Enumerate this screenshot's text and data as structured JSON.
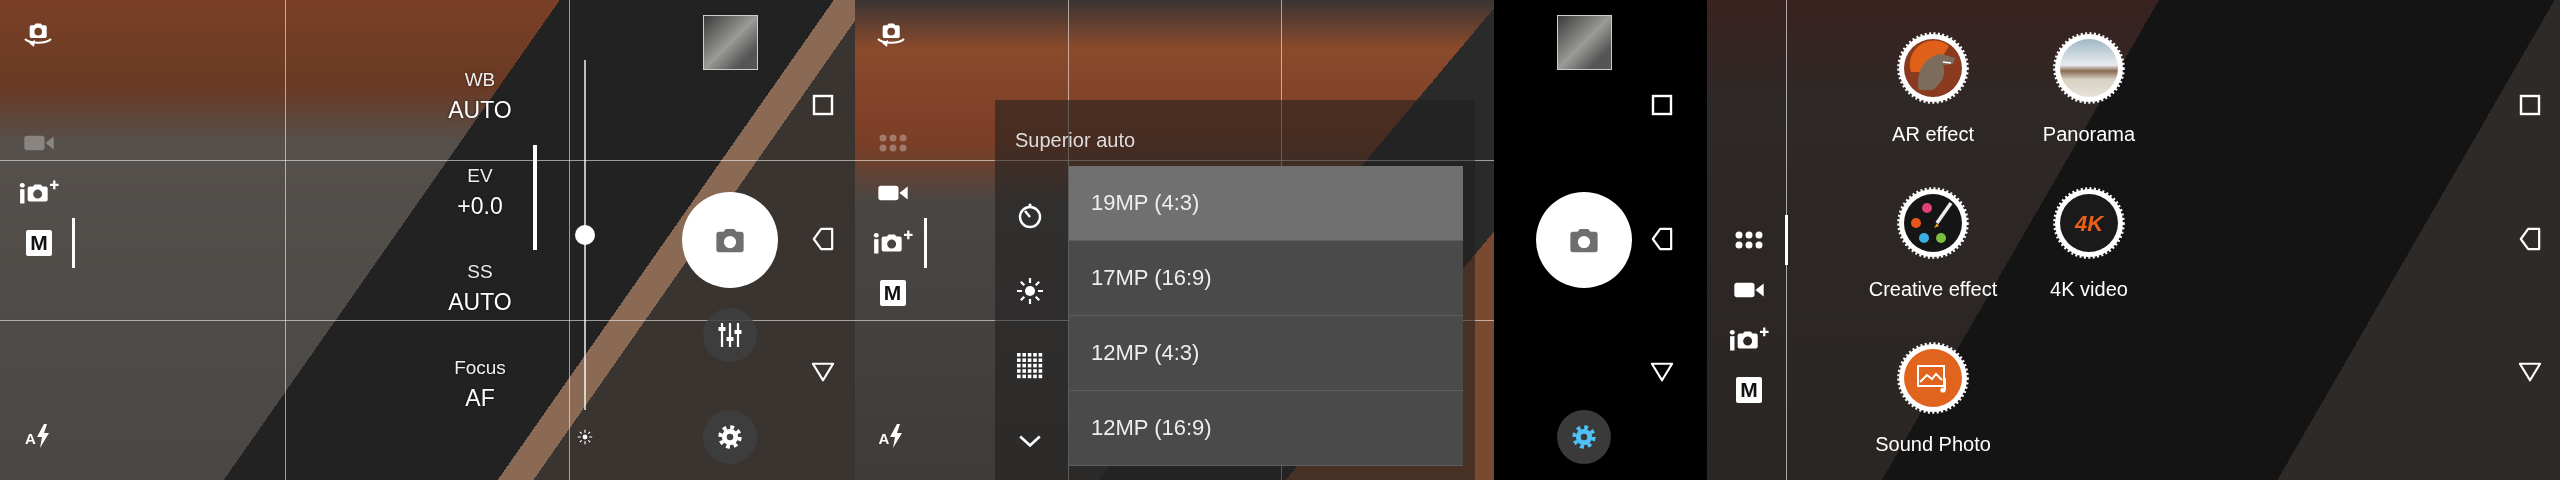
{
  "screens": [
    {
      "kind": "manual",
      "top_button": {
        "kind": "switch_camera"
      },
      "modes": [
        {
          "kind": "video",
          "selected": false,
          "dimmed": true
        },
        {
          "kind": "superior_auto",
          "selected": false,
          "dimmed": false
        },
        {
          "kind": "manual",
          "label": "M",
          "selected": true,
          "dimmed": false
        }
      ],
      "flash": {
        "label": "A"
      },
      "manual_settings": [
        {
          "label": "WB",
          "value": "AUTO"
        },
        {
          "label": "EV",
          "value": "+0.0"
        },
        {
          "label": "SS",
          "value": "AUTO"
        },
        {
          "label": "Focus",
          "value": "AF"
        }
      ],
      "brightness": {
        "level": 0.5
      },
      "controls": {
        "settings_highlighted": false
      }
    },
    {
      "kind": "menu",
      "top_button": {
        "kind": "switch_camera"
      },
      "modes": [
        {
          "kind": "mode_grid",
          "selected": false,
          "dimmed": true
        },
        {
          "kind": "video",
          "selected": false,
          "dimmed": false
        },
        {
          "kind": "superior_auto",
          "selected": true,
          "dimmed": false
        },
        {
          "kind": "manual",
          "label": "M",
          "selected": false,
          "dimmed": false
        }
      ],
      "flash": {
        "label": "A"
      },
      "menu": {
        "title": "Superior auto",
        "tools": [
          {
            "kind": "timer"
          },
          {
            "kind": "brightness"
          },
          {
            "kind": "grid"
          },
          {
            "kind": "more"
          }
        ],
        "options": [
          {
            "label": "19MP (4:3)",
            "selected": true
          },
          {
            "label": "17MP (16:9)",
            "selected": false
          },
          {
            "label": "12MP (4:3)",
            "selected": false
          },
          {
            "label": "12MP (16:9)",
            "selected": false
          }
        ]
      }
    },
    {
      "kind": "controls",
      "controls": {
        "settings_highlighted": true
      }
    },
    {
      "kind": "modes",
      "modes": [
        {
          "kind": "mode_grid",
          "selected": true,
          "dimmed": false
        },
        {
          "kind": "video",
          "selected": false,
          "dimmed": false
        },
        {
          "kind": "superior_auto",
          "selected": false,
          "dimmed": false
        },
        {
          "kind": "manual",
          "label": "M",
          "selected": false,
          "dimmed": false
        }
      ],
      "camera_modes": [
        {
          "kind": "ar",
          "label": "AR effect"
        },
        {
          "kind": "creative",
          "label": "Creative effect"
        },
        {
          "kind": "sound_photo",
          "label": "Sound Photo"
        },
        {
          "kind": "panorama",
          "label": "Panorama"
        },
        {
          "kind": "uhd",
          "label": "4K video",
          "icon_text": "4K"
        }
      ]
    }
  ]
}
